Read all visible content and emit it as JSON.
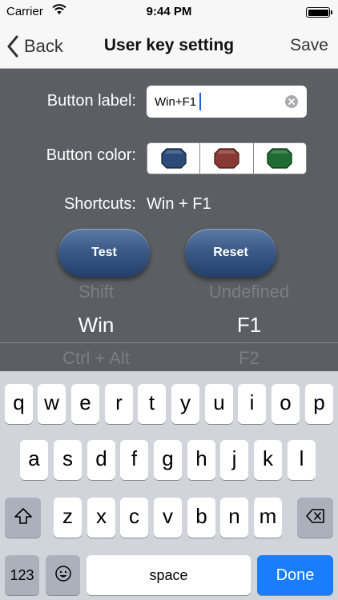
{
  "status_bar": {
    "carrier": "Carrier",
    "time": "9:44 PM"
  },
  "nav": {
    "back_label": "Back",
    "title": "User key setting",
    "save_label": "Save"
  },
  "form": {
    "button_label_title": "Button label:",
    "button_label_value": "Win+F1",
    "button_color_title": "Button color:",
    "colors": {
      "blue": "#2b4a78",
      "red": "#8a3a33",
      "green": "#1e6b34"
    },
    "shortcuts_title": "Shortcuts:",
    "shortcuts_value": "Win + F1",
    "test_label": "Test",
    "reset_label": "Reset"
  },
  "picker": {
    "left_above": "Shift",
    "left_selected": "Win",
    "left_below": "Ctrl + Alt",
    "right_above": "Undefined",
    "right_selected": "F1",
    "right_below": "F2"
  },
  "keyboard": {
    "row1": [
      "q",
      "w",
      "e",
      "r",
      "t",
      "y",
      "u",
      "i",
      "o",
      "p"
    ],
    "row2": [
      "a",
      "s",
      "d",
      "f",
      "g",
      "h",
      "j",
      "k",
      "l"
    ],
    "row3": [
      "z",
      "x",
      "c",
      "v",
      "b",
      "n",
      "m"
    ],
    "numbers_label": "123",
    "space_label": "space",
    "done_label": "Done"
  }
}
